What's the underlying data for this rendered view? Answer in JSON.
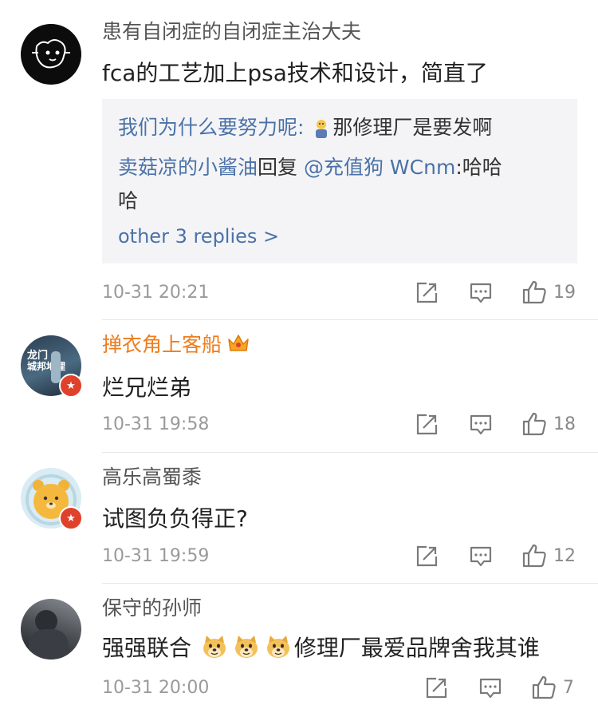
{
  "comments": [
    {
      "username": "患有自闭症的自闭症主治大夫",
      "text": "fca的工艺加上psa技术和设计，简直了",
      "replies": [
        {
          "author": "我们为什么要努力呢:",
          "text": "那修理厂是要发啊"
        },
        {
          "author": "卖菇凉的小酱油",
          "mid": "回复",
          "mention": "@充值狗 WCnm",
          "text": ":哈哈",
          "text2": "哈"
        }
      ],
      "more_replies": "other 3 replies >",
      "timestamp": "10-31 20:21",
      "likes": "19"
    },
    {
      "username": "掸衣角上客船",
      "avatar_text1": "龙门",
      "avatar_text2": "城邦地理",
      "text": "烂兄烂弟",
      "timestamp": "10-31 19:58",
      "likes": "18"
    },
    {
      "username": "高乐高蜀黍",
      "text": "试图负负得正?",
      "timestamp": "10-31 19:59",
      "likes": "12"
    },
    {
      "username": "保守的孙师",
      "text_before": "强强联合",
      "text_after": "修理厂最爱品牌舍我其谁",
      "timestamp": "10-31 20:00",
      "likes": "7"
    }
  ],
  "colors": {
    "link": "#4a72a8",
    "username_vip": "#ee7d1e",
    "badge": "#e0412b"
  }
}
